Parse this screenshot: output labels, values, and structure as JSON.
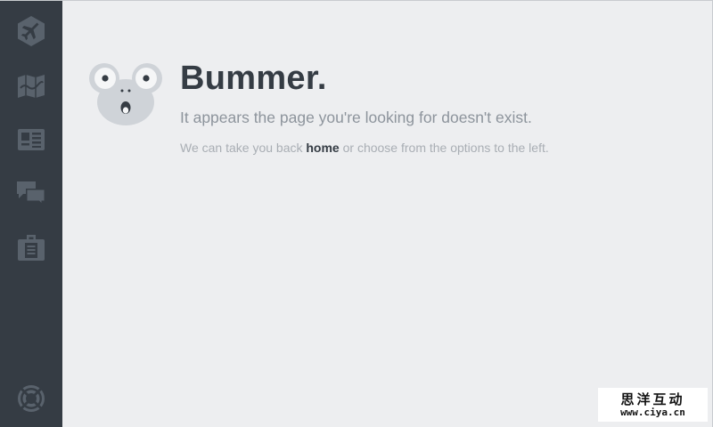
{
  "sidebar": {
    "items": [
      {
        "icon": "tag-airplane-icon",
        "label": "home"
      },
      {
        "icon": "map-icon",
        "label": "map"
      },
      {
        "icon": "profile-card-icon",
        "label": "profile"
      },
      {
        "icon": "chat-bubbles-icon",
        "label": "messages"
      },
      {
        "icon": "briefcase-icon",
        "label": "work"
      }
    ],
    "bottom": {
      "icon": "lifebuoy-icon",
      "label": "help"
    }
  },
  "error": {
    "mascot_icon": "koala-face-icon",
    "title": "Bummer.",
    "subtitle": "It appears the page you're looking for doesn't exist.",
    "hint_prefix": "We can take you back ",
    "hint_link": "home",
    "hint_suffix": " or choose from the options to the left."
  },
  "watermark": {
    "chinese": "思洋互动",
    "url": "www.ciya.cn"
  },
  "colors": {
    "sidebar_bg": "#353c44",
    "icon_color": "#59626c",
    "page_bg": "#edeef0",
    "title_color": "#353c44",
    "text_muted": "#8d949c"
  }
}
